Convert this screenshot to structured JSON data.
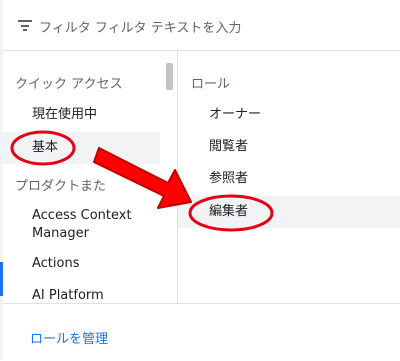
{
  "filter": {
    "placeholder": "フィルタ フィルタ テキストを入力",
    "icon": "filter-icon"
  },
  "categories": {
    "quick_access_heading": "クイック アクセス",
    "quick_access": [
      {
        "label": "現在使用中"
      },
      {
        "label": "基本"
      }
    ],
    "products_heading": "プロダクトまた",
    "products": [
      {
        "label": "Access Context Manager"
      },
      {
        "label": "Actions"
      },
      {
        "label": "AI Platform"
      }
    ]
  },
  "roles": {
    "heading": "ロール",
    "items": [
      {
        "label": "オーナー"
      },
      {
        "label": "閲覧者"
      },
      {
        "label": "参照者"
      },
      {
        "label": "編集者"
      }
    ]
  },
  "footer": {
    "manage_link": "ロールを管理"
  },
  "colors": {
    "annotation": "#e60012",
    "link": "#1a73e8",
    "selected_bg": "#f1f3f4"
  }
}
